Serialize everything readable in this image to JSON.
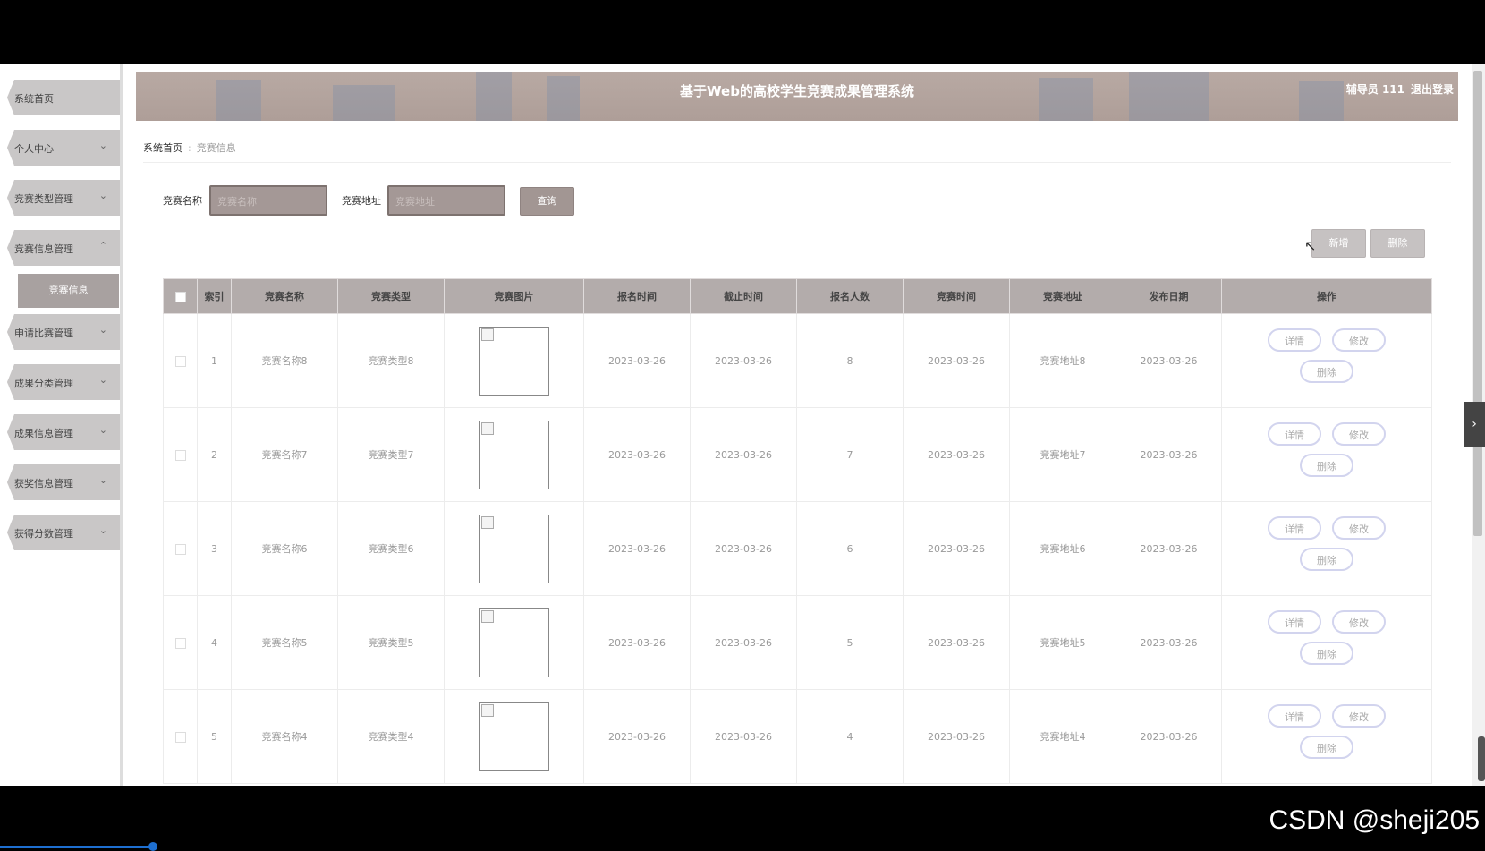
{
  "header": {
    "title": "基于Web的高校学生竞赛成果管理系统",
    "user": "辅导员 111",
    "logout": "退出登录"
  },
  "sidebar": {
    "items": [
      {
        "label": "系统首页",
        "chevron": ""
      },
      {
        "label": "个人中心",
        "chevron": "⌄"
      },
      {
        "label": "竞赛类型管理",
        "chevron": "⌄"
      },
      {
        "label": "竞赛信息管理",
        "chevron": "⌃"
      },
      {
        "label": "申请比赛管理",
        "chevron": "⌄"
      },
      {
        "label": "成果分类管理",
        "chevron": "⌄"
      },
      {
        "label": "成果信息管理",
        "chevron": "⌄"
      },
      {
        "label": "获奖信息管理",
        "chevron": "⌄"
      },
      {
        "label": "获得分数管理",
        "chevron": "⌄"
      }
    ],
    "active_sub": "竞赛信息"
  },
  "breadcrumb": {
    "home": "系统首页",
    "sep": ":",
    "current": "竞赛信息"
  },
  "search": {
    "name_label": "竞赛名称",
    "name_placeholder": "竞赛名称",
    "address_label": "竞赛地址",
    "address_placeholder": "竞赛地址",
    "query": "查询"
  },
  "actions": {
    "add": "新增",
    "delete": "删除"
  },
  "table": {
    "headers": [
      "索引",
      "竞赛名称",
      "竞赛类型",
      "竞赛图片",
      "报名时间",
      "截止时间",
      "报名人数",
      "竞赛时间",
      "竞赛地址",
      "发布日期",
      "操作"
    ],
    "rows": [
      {
        "index": "1",
        "name": "竞赛名称8",
        "type": "竞赛类型8",
        "signup": "2023-03-26",
        "deadline": "2023-03-26",
        "count": "8",
        "time": "2023-03-26",
        "address": "竞赛地址8",
        "publish": "2023-03-26"
      },
      {
        "index": "2",
        "name": "竞赛名称7",
        "type": "竞赛类型7",
        "signup": "2023-03-26",
        "deadline": "2023-03-26",
        "count": "7",
        "time": "2023-03-26",
        "address": "竞赛地址7",
        "publish": "2023-03-26"
      },
      {
        "index": "3",
        "name": "竞赛名称6",
        "type": "竞赛类型6",
        "signup": "2023-03-26",
        "deadline": "2023-03-26",
        "count": "6",
        "time": "2023-03-26",
        "address": "竞赛地址6",
        "publish": "2023-03-26"
      },
      {
        "index": "4",
        "name": "竞赛名称5",
        "type": "竞赛类型5",
        "signup": "2023-03-26",
        "deadline": "2023-03-26",
        "count": "5",
        "time": "2023-03-26",
        "address": "竞赛地址5",
        "publish": "2023-03-26"
      },
      {
        "index": "5",
        "name": "竞赛名称4",
        "type": "竞赛类型4",
        "signup": "2023-03-26",
        "deadline": "2023-03-26",
        "count": "4",
        "time": "2023-03-26",
        "address": "竞赛地址4",
        "publish": "2023-03-26"
      }
    ],
    "row_ops": {
      "detail": "详情",
      "edit": "修改",
      "delete": "删除"
    }
  },
  "side_tab_icon": "chevron-right-icon",
  "watermark": "CSDN @sheji205"
}
